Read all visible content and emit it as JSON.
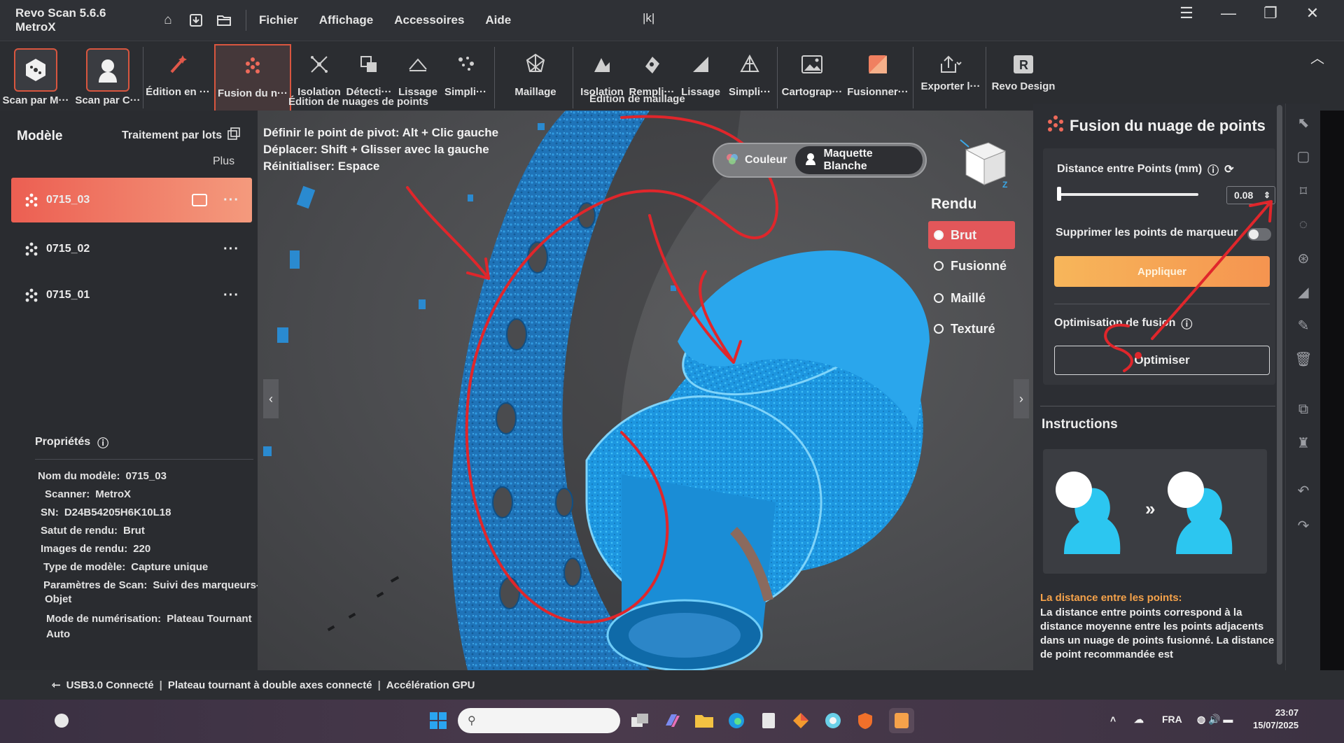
{
  "titlebar": {
    "app_name": "Revo Scan 5.6.6 MetroX",
    "menu": [
      "Fichier",
      "Affichage",
      "Accessoires",
      "Aide"
    ],
    "doc_title": "|k|"
  },
  "ribbon": {
    "scan_marker": "Scan par M···",
    "scan_color": "Scan par C···",
    "edit": "Édition en ···",
    "fusion": "Fusion du n···",
    "isolation1": "Isolation",
    "detection": "Détecti···",
    "smoothing1": "Lissage",
    "simplify1": "Simpli···",
    "meshing": "Maillage",
    "isolation2": "Isolation",
    "fill": "Rempli···",
    "smoothing2": "Lissage",
    "simplify2": "Simpli···",
    "mapping": "Cartograp···",
    "merge": "Fusionner···",
    "export": "Exporter l···",
    "revo_design": "Revo Design",
    "group_point_cloud": "Édition de nuages de points",
    "group_mesh": "Édition de maillage"
  },
  "left": {
    "title": "Modèle",
    "batch": "Traitement par lots",
    "more": "Plus",
    "models": [
      {
        "name": "0715_03"
      },
      {
        "name": "0715_02"
      },
      {
        "name": "0715_01"
      }
    ],
    "props_title": "Propriétés",
    "props": [
      {
        "k": "Nom du modèle:",
        "v": "0715_03"
      },
      {
        "k": "Scanner:",
        "v": "MetroX"
      },
      {
        "k": "SN:",
        "v": "D24B54205H6K10L18"
      },
      {
        "k": "Satut de rendu:",
        "v": "Brut"
      },
      {
        "k": "Images de rendu:",
        "v": "220"
      },
      {
        "k": "Type de modèle:",
        "v": "Capture unique"
      },
      {
        "k": "Paramètres de Scan:",
        "v": "Suivi des marqueurs-"
      },
      {
        "k": "",
        "v": "Objet"
      },
      {
        "k": "Mode de numérisation:",
        "v": "Plateau Tournant"
      },
      {
        "k": "",
        "v": "Auto"
      }
    ]
  },
  "viewport": {
    "hints": [
      "Définir le point de pivot: Alt + Clic gauche",
      "Déplacer: Shift + Glisser avec la gauche",
      "Réinitialiser: Espace"
    ],
    "mode_color": "Couleur",
    "mode_white": "Maquette Blanche",
    "render_title": "Rendu",
    "render_options": [
      "Brut",
      "Fusionné",
      "Maillé",
      "Texturé"
    ],
    "render_selected": "Brut",
    "accent": "#e2575a"
  },
  "right": {
    "title": "Fusion du nuage de points",
    "distance_label": "Distance entre Points (mm)",
    "distance_value": "0.08",
    "marker_label": "Supprimer les points de marqueur",
    "marker_enabled": false,
    "apply": "Appliquer",
    "opt_label": "Optimisation de fusion",
    "optimize": "Optimiser",
    "instructions": "Instructions",
    "note_head": "La distance entre les points:",
    "note_body": "La distance entre points correspond à la distance moyenne entre les points adjacents dans un nuage de points fusionné. La distance de point recommandée est"
  },
  "status": {
    "usb": "USB3.0 Connecté",
    "turntable": "Plateau tournant à double axes connecté",
    "gpu": "Accélération GPU"
  },
  "taskbar": {
    "lang": "FRA",
    "time": "23:07",
    "date": "15/07/2025"
  }
}
